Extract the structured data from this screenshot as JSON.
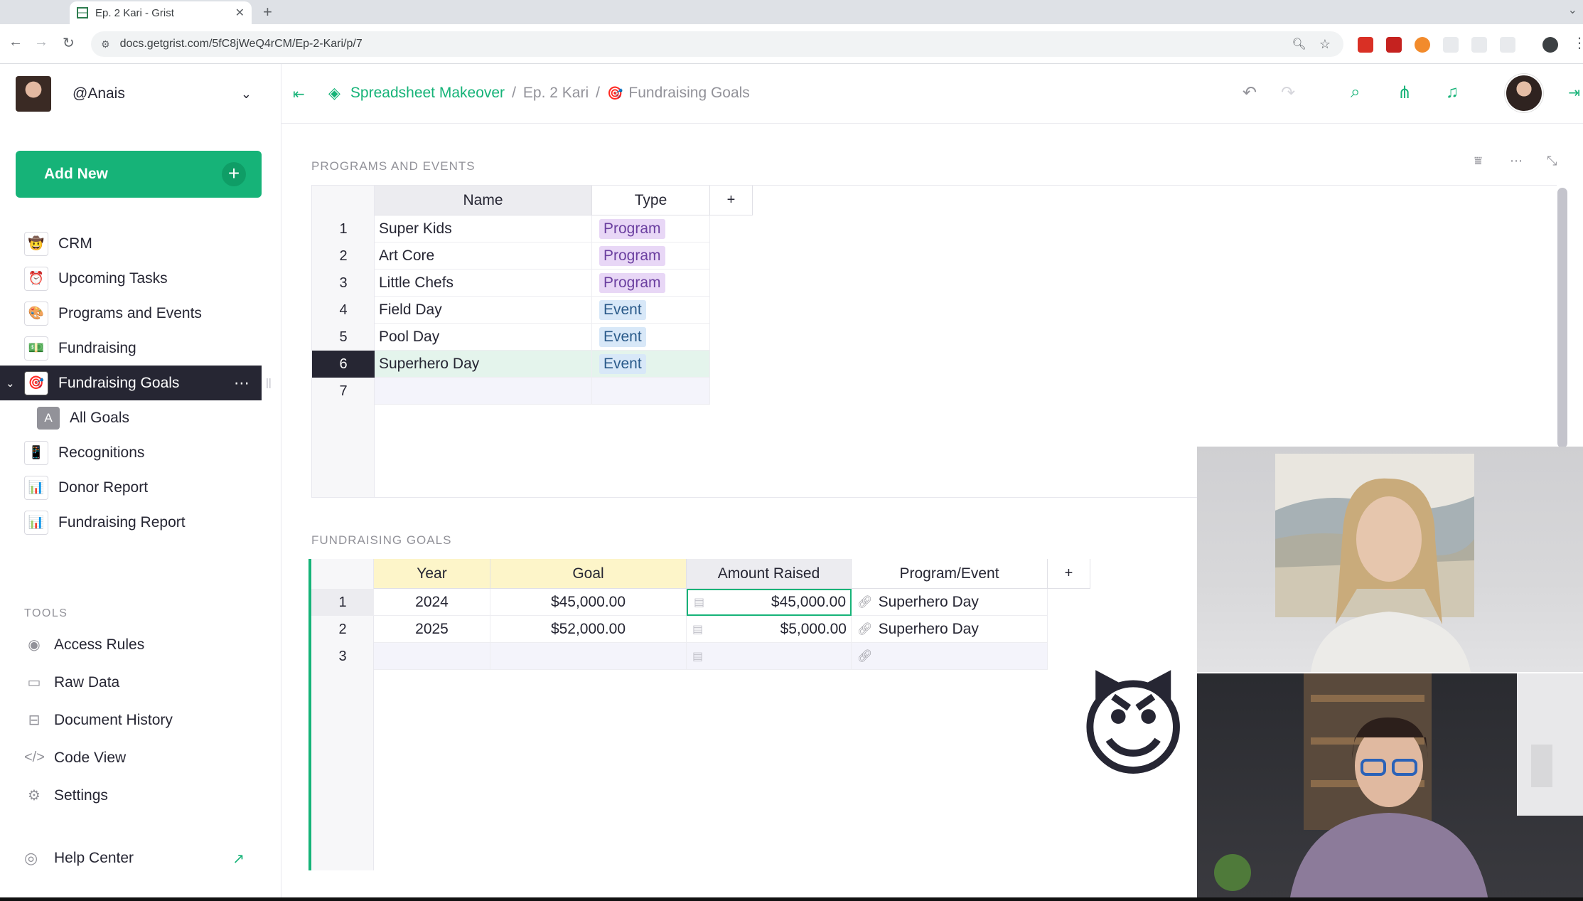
{
  "browser": {
    "tab_title": "Ep. 2 Kari - Grist",
    "url": "docs.getgrist.com/5fC8jWeQ4rCM/Ep-2-Kari/p/7"
  },
  "user": {
    "name": "@Anais"
  },
  "add_new": {
    "label": "Add New"
  },
  "pages": [
    {
      "label": "CRM",
      "icon": "🤠"
    },
    {
      "label": "Upcoming Tasks",
      "icon": "⏰"
    },
    {
      "label": "Programs and Events",
      "icon": "🎨"
    },
    {
      "label": "Fundraising",
      "icon": "💵"
    },
    {
      "label": "Fundraising Goals",
      "icon": "🎯"
    },
    {
      "label": "All Goals",
      "icon": "A"
    },
    {
      "label": "Recognitions",
      "icon": "📱"
    },
    {
      "label": "Donor Report",
      "icon": "📊"
    },
    {
      "label": "Fundraising Report",
      "icon": "📊"
    }
  ],
  "tools": {
    "label": "TOOLS",
    "items": [
      {
        "label": "Access Rules",
        "icon": "eye-icon"
      },
      {
        "label": "Raw Data",
        "icon": "database-icon"
      },
      {
        "label": "Document History",
        "icon": "history-icon"
      },
      {
        "label": "Code View",
        "icon": "code-icon"
      },
      {
        "label": "Settings",
        "icon": "gear-icon"
      }
    ]
  },
  "help": {
    "label": "Help Center"
  },
  "breadcrumb": {
    "workspace": "Spreadsheet Makeover",
    "sep": "/",
    "document": "Ep. 2 Kari",
    "page": "Fundraising Goals"
  },
  "programs_section": {
    "title": "PROGRAMS AND EVENTS",
    "columns": [
      "Name",
      "Type"
    ],
    "add_column": "+",
    "rows": [
      {
        "n": "1",
        "name": "Super Kids",
        "type": "Program"
      },
      {
        "n": "2",
        "name": "Art Core",
        "type": "Program"
      },
      {
        "n": "3",
        "name": "Little Chefs",
        "type": "Program"
      },
      {
        "n": "4",
        "name": "Field Day",
        "type": "Event"
      },
      {
        "n": "5",
        "name": "Pool Day",
        "type": "Event"
      },
      {
        "n": "6",
        "name": "Superhero Day",
        "type": "Event"
      },
      {
        "n": "7",
        "name": "",
        "type": ""
      }
    ]
  },
  "goals_section": {
    "title": "FUNDRAISING GOALS",
    "columns": [
      "Year",
      "Goal",
      "Amount Raised",
      "Program/Event"
    ],
    "add_column": "+",
    "rows": [
      {
        "n": "1",
        "year": "2024",
        "goal": "$45,000.00",
        "raised": "$45,000.00",
        "program": "Superhero Day"
      },
      {
        "n": "2",
        "year": "2025",
        "goal": "$52,000.00",
        "raised": "$5,000.00",
        "program": "Superhero Day"
      },
      {
        "n": "3",
        "year": "",
        "goal": "",
        "raised": "",
        "program": ""
      }
    ]
  },
  "colors": {
    "accent": "#16b378",
    "dark": "#262633",
    "program_chip": "#e8d7f6",
    "event_chip": "#d8e8f8",
    "year_goal_header": "#fdf5c9"
  }
}
